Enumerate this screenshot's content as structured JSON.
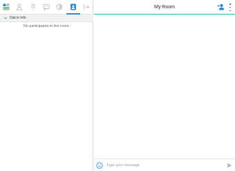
{
  "tabs": [
    {
      "name": "tab-layout",
      "icon": "layout-icon",
      "active": false
    },
    {
      "name": "tab-participants",
      "icon": "person-icon",
      "active": false
    },
    {
      "name": "tab-dialpad",
      "icon": "dialpad-icon",
      "active": false
    },
    {
      "name": "tab-chat",
      "icon": "chat-icon",
      "active": false
    },
    {
      "name": "tab-settings",
      "icon": "settings-icon",
      "active": false
    },
    {
      "name": "tab-dial-in",
      "icon": "dial-in-icon",
      "active": true
    },
    {
      "name": "tab-collapse",
      "icon": "collapse-panel-icon",
      "active": false
    }
  ],
  "section": {
    "title": "Dial in Info"
  },
  "participants": {
    "empty_text": "No participants in the room."
  },
  "header": {
    "title": "My Room"
  },
  "composer": {
    "placeholder": "Type your message"
  },
  "colors": {
    "accent": "#2b8ad6",
    "header_underline": "#2fb5a6",
    "icon_gray": "#b5b5b5",
    "green": "#3cb85a"
  }
}
